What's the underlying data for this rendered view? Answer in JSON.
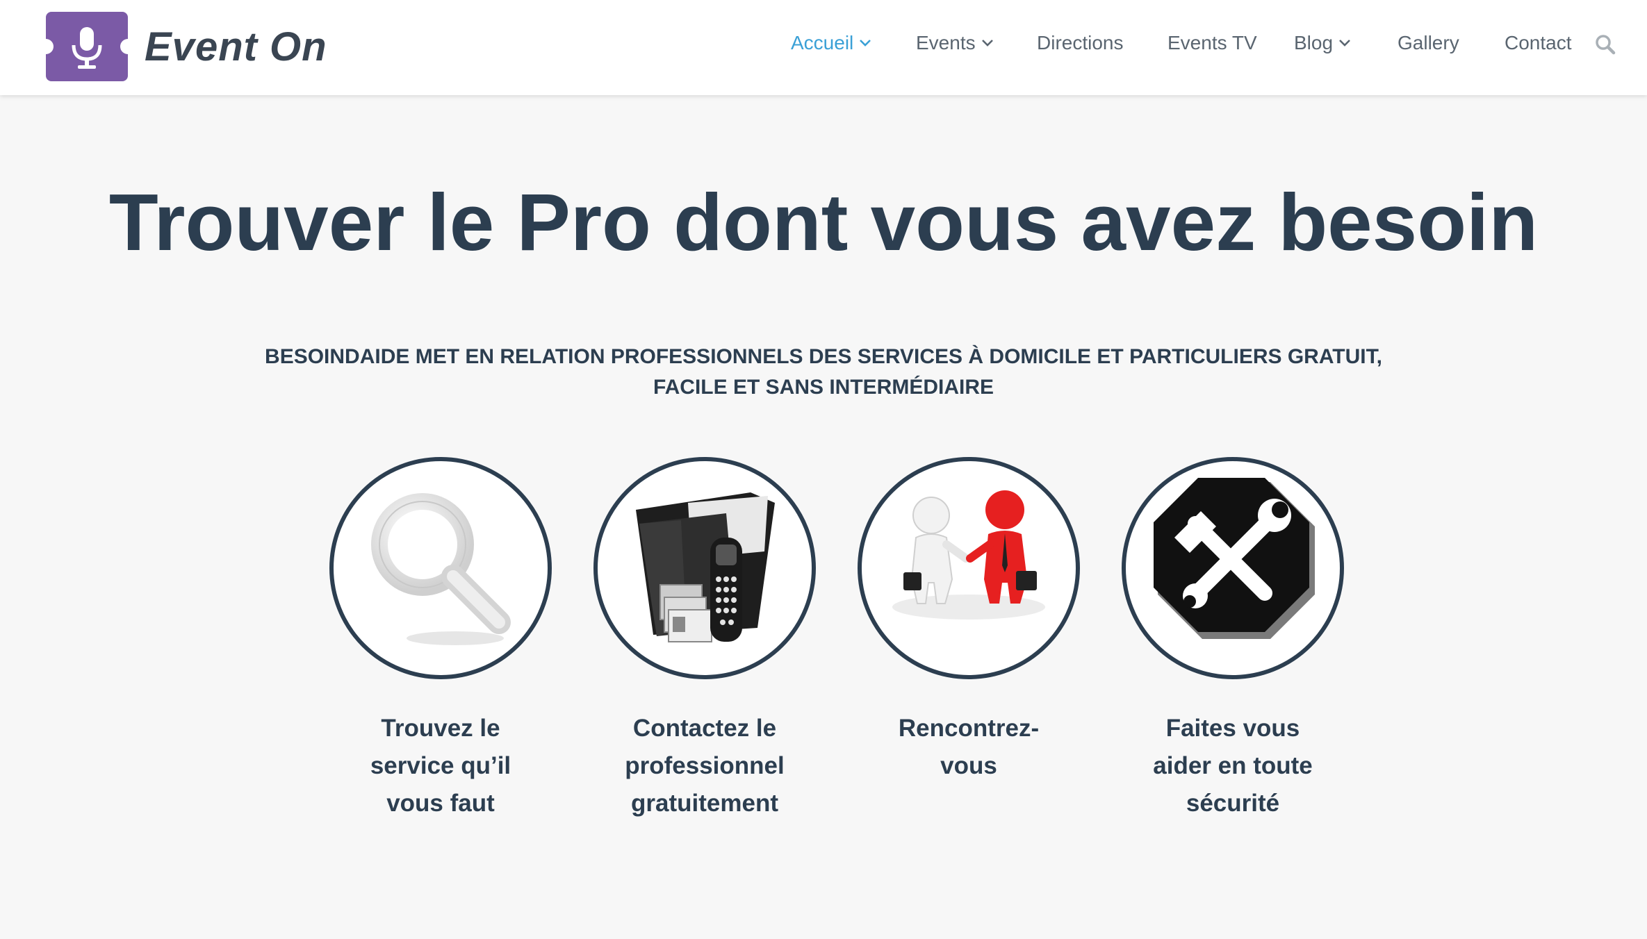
{
  "brand": {
    "name": "Event On",
    "logo_icon": "microphone-icon",
    "color": "#7b5aa6"
  },
  "nav": {
    "items": [
      {
        "label": "Accueil",
        "dropdown": true,
        "active": true
      },
      {
        "label": "Events",
        "dropdown": true,
        "active": false
      },
      {
        "label": "Directions",
        "dropdown": false,
        "active": false
      },
      {
        "label": "Events TV",
        "dropdown": false,
        "active": false
      },
      {
        "label": "Blog",
        "dropdown": true,
        "active": false
      },
      {
        "label": "Gallery",
        "dropdown": false,
        "active": false
      },
      {
        "label": "Contact",
        "dropdown": false,
        "active": false
      }
    ],
    "search_icon": "search-icon",
    "active_color": "#3aa0d6"
  },
  "hero": {
    "title": "Trouver le Pro dont vous avez besoin",
    "subtitle": "BESOINDAIDE MET EN RELATION PROFESSIONNELS DES SERVICES À DOMICILE ET PARTICULIERS GRATUIT, FACILE ET SANS INTERMÉDIAIRE"
  },
  "features": [
    {
      "label": "Trouvez le service qu’il vous faut",
      "icon": "magnifier-icon"
    },
    {
      "label": "Contactez le professionnel gratuitement",
      "icon": "contact-folder-phone-icon"
    },
    {
      "label": "Rencontrez-vous",
      "icon": "handshake-icon"
    },
    {
      "label": "Faites vous aider en toute sécurité",
      "icon": "tools-icon"
    }
  ],
  "colors": {
    "text": "#2c3e50",
    "background": "#f7f7f7"
  }
}
